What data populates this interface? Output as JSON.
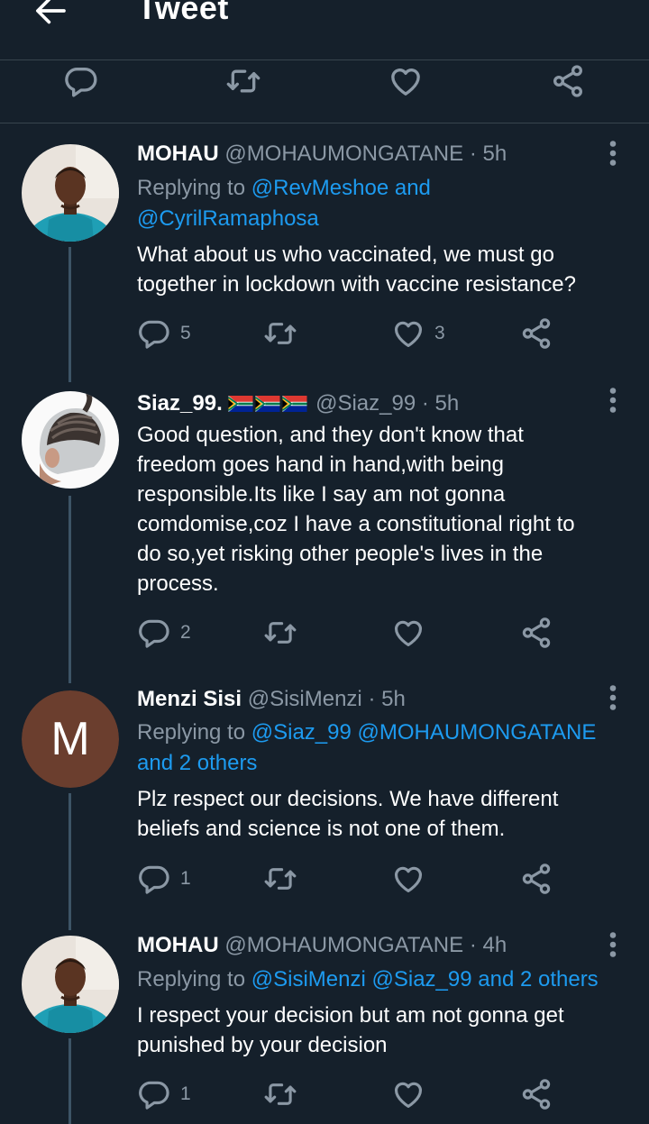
{
  "header": {
    "title": "Tweet"
  },
  "colors": {
    "background": "#15202b",
    "accent": "#1d9bf0",
    "muted": "#8b98a5",
    "divider": "#38444d"
  },
  "main_actions": [
    "reply-icon",
    "retweet-icon",
    "like-icon",
    "share-icon"
  ],
  "replies": [
    {
      "name": "MOHAU",
      "handle": "@MOHAUMONGATANE",
      "dot": "·",
      "time": "5h",
      "replying_prefix": "Replying to ",
      "mention_1": "@RevMeshoe",
      "conj": " and ",
      "mention_2": "@CyrilRamaphosa",
      "text_line_1": "What about us who vaccinated, we must go",
      "text_line_2": "together in lockdown with vaccine resistance?",
      "reply_count": "5",
      "retweet_count": "",
      "like_count": "3"
    },
    {
      "name": "Siaz_99.",
      "flags": "🇿🇦🇿🇦🇿🇦",
      "handle": "@Siaz_99",
      "dot": "·",
      "time": "5h",
      "text_line_1": "Good question, and they don't know that",
      "text_line_2": "freedom goes hand in hand,with being",
      "text_line_3": "responsible.Its like I say am not gonna",
      "text_line_4": "comdomise,coz I have a constitutional right to",
      "text_line_5": "do so,yet risking other people's lives in the",
      "text_line_6": "process.",
      "reply_count": "2"
    },
    {
      "name": "Menzi Sisi",
      "avatar_letter": "M",
      "avatar_color": "#6b3e2e",
      "handle": "@SisiMenzi",
      "dot": "·",
      "time": "5h",
      "replying_prefix": "Replying to ",
      "mention_1": "@Siaz_99",
      "mention_2": "@MOHAUMONGATANE",
      "others": "and 2 others",
      "text_line_1": "Plz respect our decisions. We have different",
      "text_line_2": "beliefs and science is not one of them.",
      "reply_count": "1"
    },
    {
      "name": "MOHAU",
      "handle": "@MOHAUMONGATANE",
      "dot": "·",
      "time": "4h",
      "replying_prefix": "Replying to ",
      "mention_1": "@SisiMenzi",
      "mention_2": "@Siaz_99",
      "others": "and 2 others",
      "text_line_1": "I respect your decision but am not gonna get",
      "text_line_2": "punished by your decision",
      "reply_count": "1"
    }
  ]
}
